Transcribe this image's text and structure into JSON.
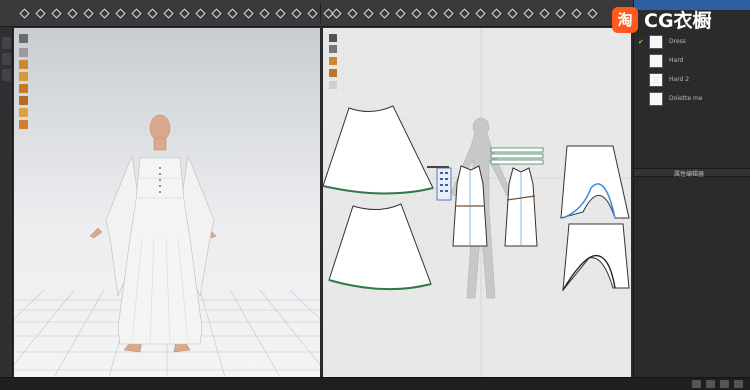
{
  "toolbar": {
    "left_tools": [
      "move-icon",
      "select-icon",
      "transform-icon",
      "rotate-icon",
      "pin-icon",
      "tack-icon",
      "measure-icon",
      "brush-icon",
      "cut-icon",
      "sew-icon",
      "fold-icon",
      "tape-icon",
      "ruler-icon",
      "texture-icon",
      "grid-icon",
      "arrow-icon",
      "point-icon",
      "avatar-icon",
      "camera-icon",
      "layers-icon"
    ],
    "right_tools": [
      "select-pattern-icon",
      "edit-point-icon",
      "polygon-icon",
      "rectangle-icon",
      "circle-icon",
      "internal-line-icon",
      "dart-icon",
      "notch-icon",
      "segment-sew-icon",
      "free-sew-icon",
      "fold-line-icon",
      "trim-icon",
      "gather-icon",
      "topstitch-icon",
      "button-icon",
      "zipper-icon",
      "measure-2d-icon"
    ]
  },
  "right_panel": {
    "header_label": "",
    "fabrics": [
      {
        "name": "Dress",
        "checked": true
      },
      {
        "name": "Hard",
        "checked": false
      },
      {
        "name": "Hard 2",
        "checked": false
      },
      {
        "name": "Dolette me",
        "checked": false
      }
    ],
    "property_header": "属性编辑器"
  },
  "watermark": {
    "logo_glyph": "淘",
    "text": "CG衣橱",
    "color": "#ff5a1e"
  },
  "colors": {
    "sewing_line": "#2f7a4a",
    "seam_blue": "#3a8ee0",
    "panel_bg": "#2b2b2d",
    "viewport2d_bg": "#e8e8e8"
  }
}
